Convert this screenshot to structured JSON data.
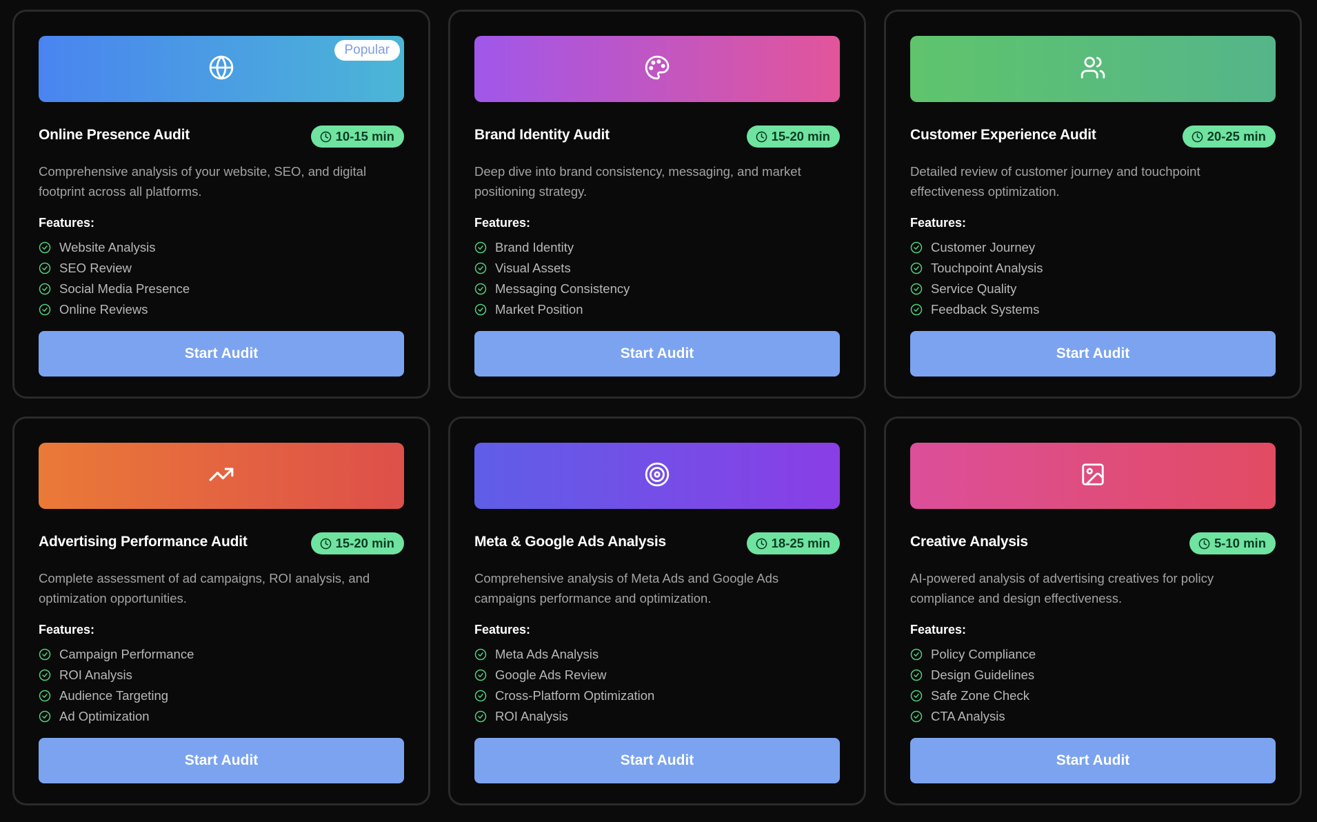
{
  "common": {
    "features_label": "Features:",
    "button_label": "Start Audit",
    "popular_label": "Popular"
  },
  "cards": [
    {
      "title": "Online Presence Audit",
      "duration": "10-15 min",
      "description": "Comprehensive analysis of your website, SEO, and digital footprint across all platforms.",
      "features": [
        "Website Analysis",
        "SEO Review",
        "Social Media Presence",
        "Online Reviews"
      ],
      "icon": "globe-icon",
      "gradient": [
        "#4a84f0",
        "#4bb6d6"
      ],
      "popular": true
    },
    {
      "title": "Brand Identity Audit",
      "duration": "15-20 min",
      "description": "Deep dive into brand consistency, messaging, and market positioning strategy.",
      "features": [
        "Brand Identity",
        "Visual Assets",
        "Messaging Consistency",
        "Market Position"
      ],
      "icon": "palette-icon",
      "gradient": [
        "#a057ea",
        "#e2559a"
      ],
      "popular": false
    },
    {
      "title": "Customer Experience Audit",
      "duration": "20-25 min",
      "description": "Detailed review of customer journey and touchpoint effectiveness optimization.",
      "features": [
        "Customer Journey",
        "Touchpoint Analysis",
        "Service Quality",
        "Feedback Systems"
      ],
      "icon": "users-icon",
      "gradient": [
        "#5fc46c",
        "#55b58a"
      ],
      "popular": false
    },
    {
      "title": "Advertising Performance Audit",
      "duration": "15-20 min",
      "description": "Complete assessment of ad campaigns, ROI analysis, and optimization opportunities.",
      "features": [
        "Campaign Performance",
        "ROI Analysis",
        "Audience Targeting",
        "Ad Optimization"
      ],
      "icon": "trending-up-icon",
      "gradient": [
        "#ea7a37",
        "#de4f4a"
      ],
      "popular": false
    },
    {
      "title": "Meta & Google Ads Analysis",
      "duration": "18-25 min",
      "description": "Comprehensive analysis of Meta Ads and Google Ads campaigns performance and optimization.",
      "features": [
        "Meta Ads Analysis",
        "Google Ads Review",
        "Cross-Platform Optimization",
        "ROI Analysis"
      ],
      "icon": "target-icon",
      "gradient": [
        "#5f5ee8",
        "#8a3ee6"
      ],
      "popular": false
    },
    {
      "title": "Creative Analysis",
      "duration": "5-10 min",
      "description": "AI-powered analysis of advertising creatives for policy compliance and design effectiveness.",
      "features": [
        "Policy Compliance",
        "Design Guidelines",
        "Safe Zone Check",
        "CTA Analysis"
      ],
      "icon": "image-icon",
      "gradient": [
        "#dc4f9a",
        "#e24b62"
      ],
      "popular": false
    }
  ]
}
